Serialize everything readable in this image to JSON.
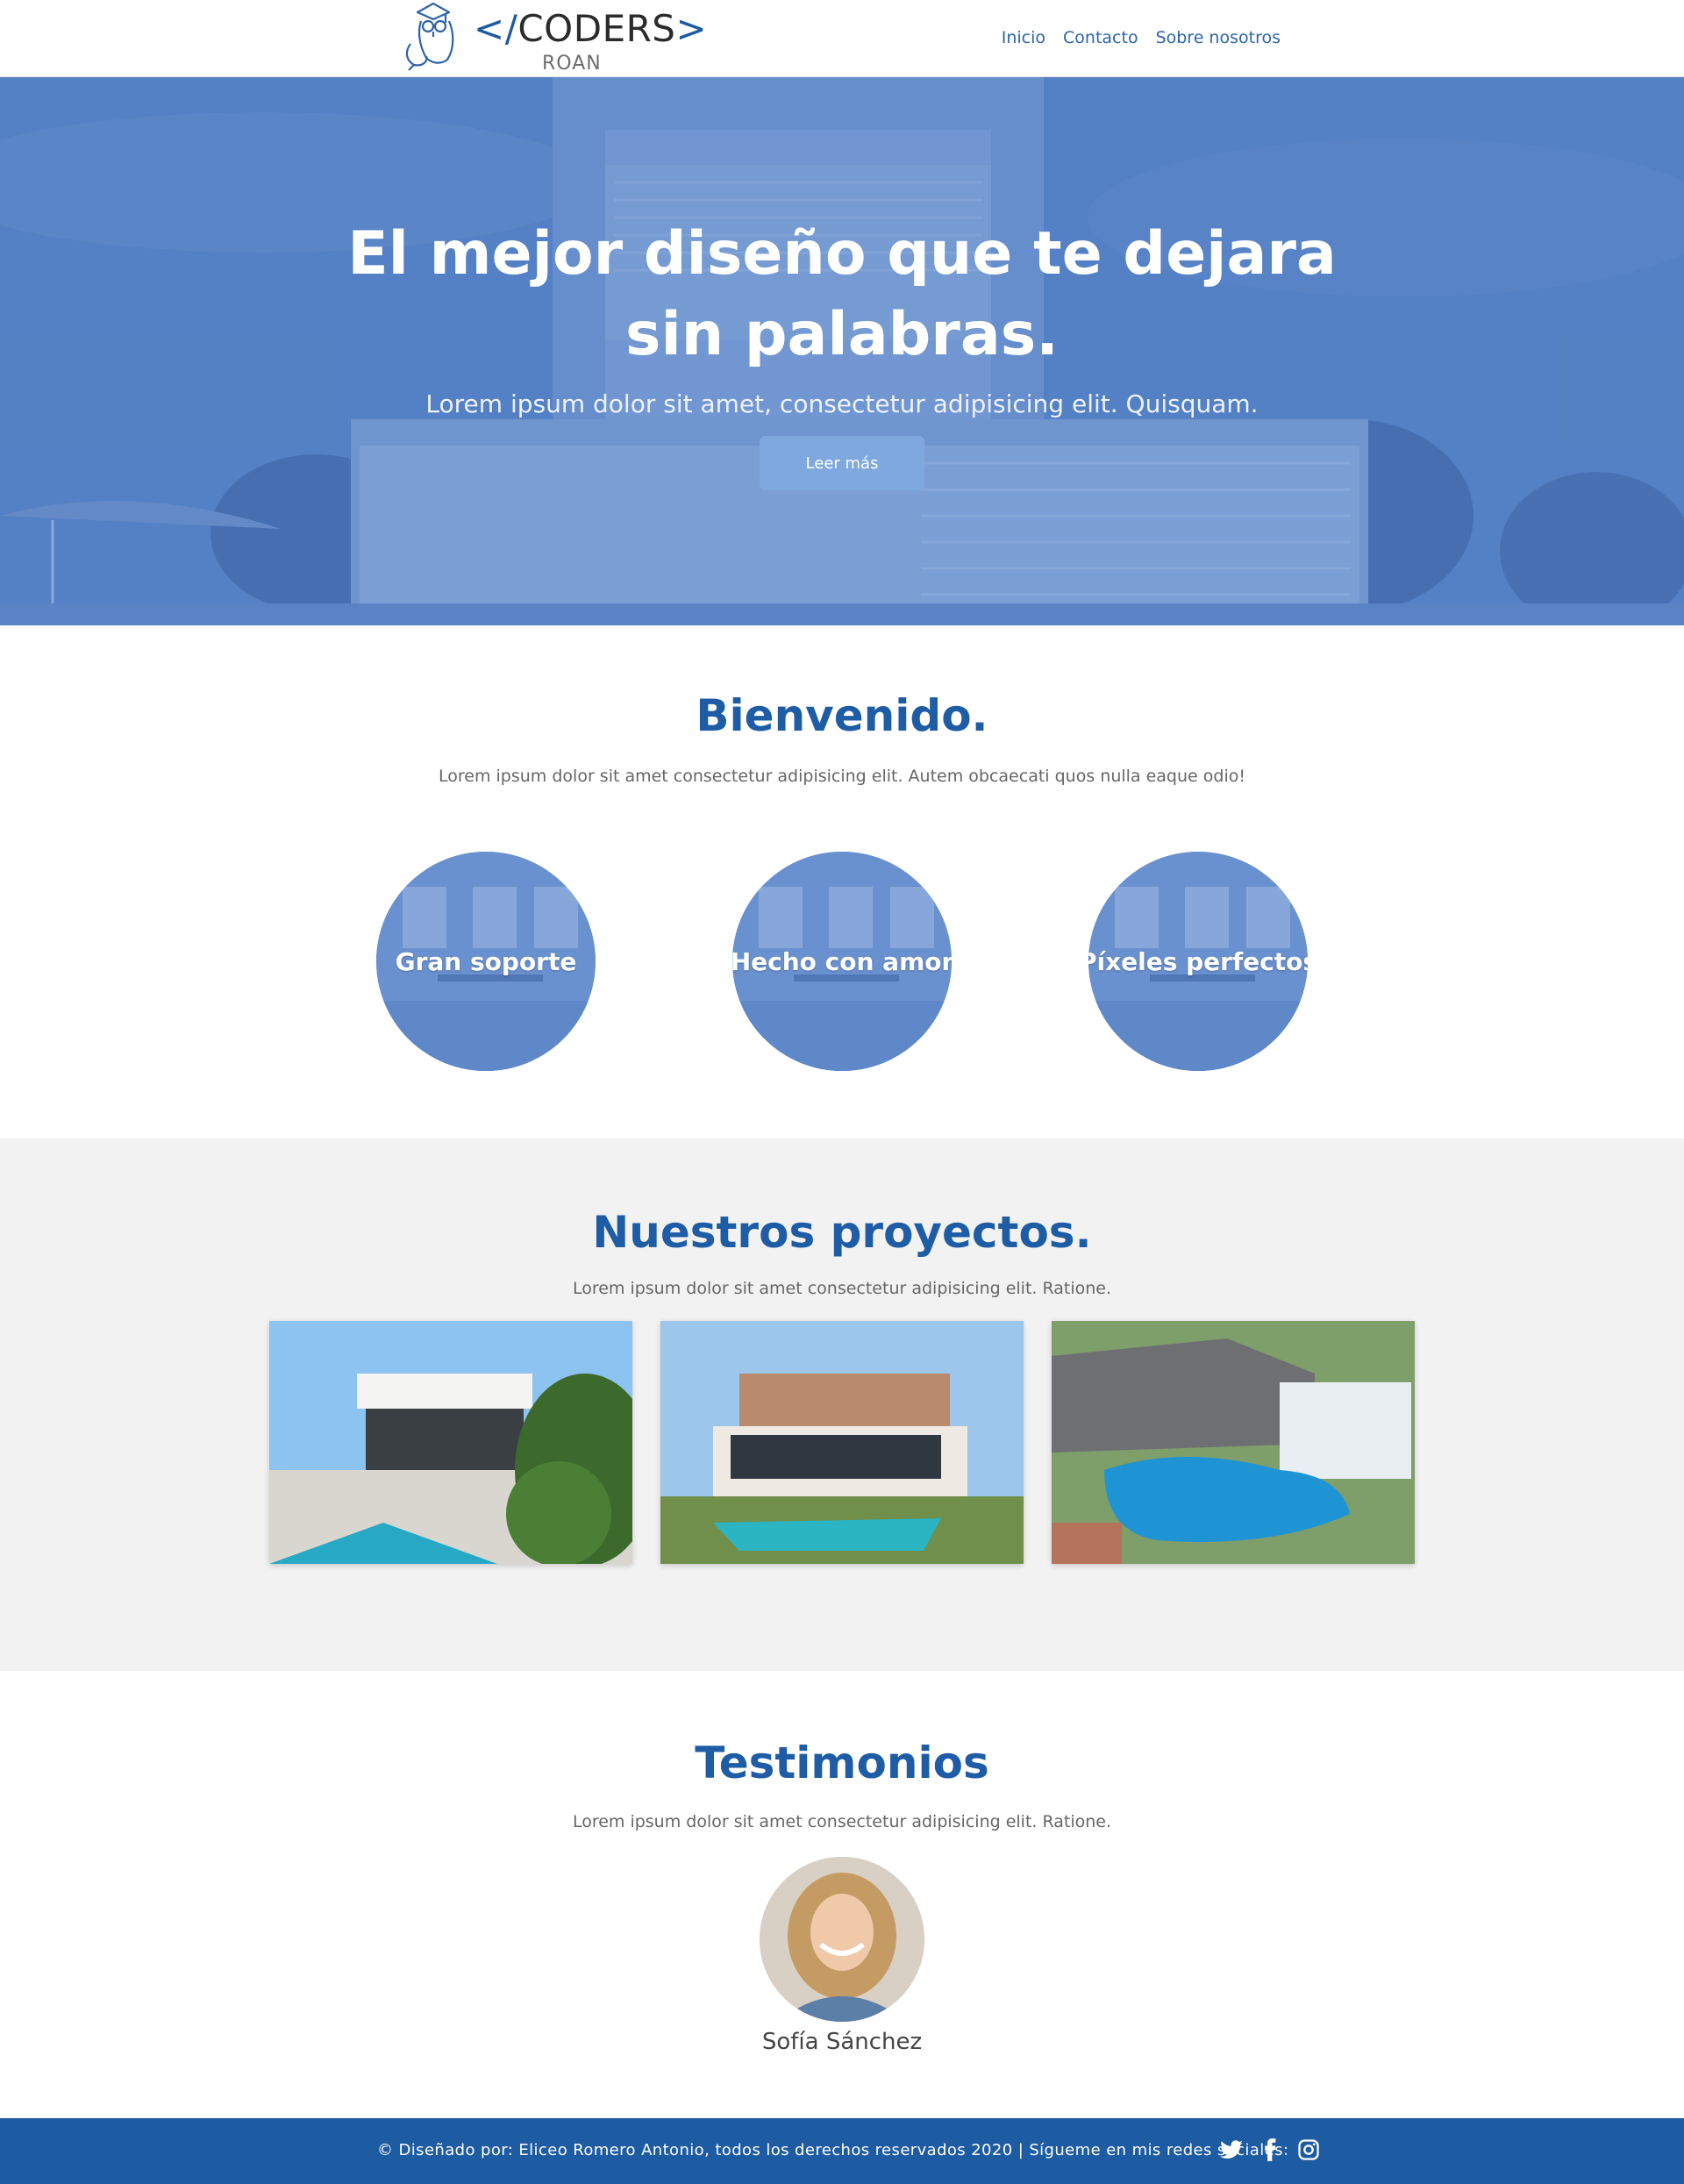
{
  "nav": {
    "logo_text": "</CODERS>",
    "logo_open": "</",
    "logo_word": "CODERS",
    "logo_close": ">",
    "logo_sub": "ROAN",
    "items": [
      "Inicio",
      "Contacto",
      "Sobre nosotros"
    ]
  },
  "hero": {
    "title": "El mejor diseño que te dejara sin palabras.",
    "subtitle": "Lorem ipsum dolor sit amet, consectetur adipisicing elit. Quisquam.",
    "button": "Leer más"
  },
  "welcome": {
    "title": "Bienvenido.",
    "subtitle": "Lorem ipsum dolor sit amet consectetur adipisicing elit. Autem obcaecati quos nulla eaque odio!",
    "features": [
      "Gran soporte",
      "Hecho con amor",
      "Píxeles perfectos"
    ]
  },
  "projects": {
    "title": "Nuestros proyectos.",
    "subtitle": "Lorem ipsum dolor sit amet consectetur adipisicing elit. Ratione."
  },
  "testimonials": {
    "title": "Testimonios",
    "subtitle": "Lorem ipsum dolor sit amet consectetur adipisicing elit. Ratione.",
    "name": "Sofía Sánchez"
  },
  "footer": {
    "text": "© Diseñado por: Eliceo Romero Antonio, todos los derechos reservados 2020 | Sígueme en mis redes sociales:",
    "social": [
      "twitter-icon",
      "facebook-icon",
      "instagram-icon"
    ]
  },
  "colors": {
    "brand": "#1e5ca6",
    "footer": "#1d5ba3",
    "hero_overlay": "#4c7cc4",
    "section_gray": "#f2f2f2"
  }
}
